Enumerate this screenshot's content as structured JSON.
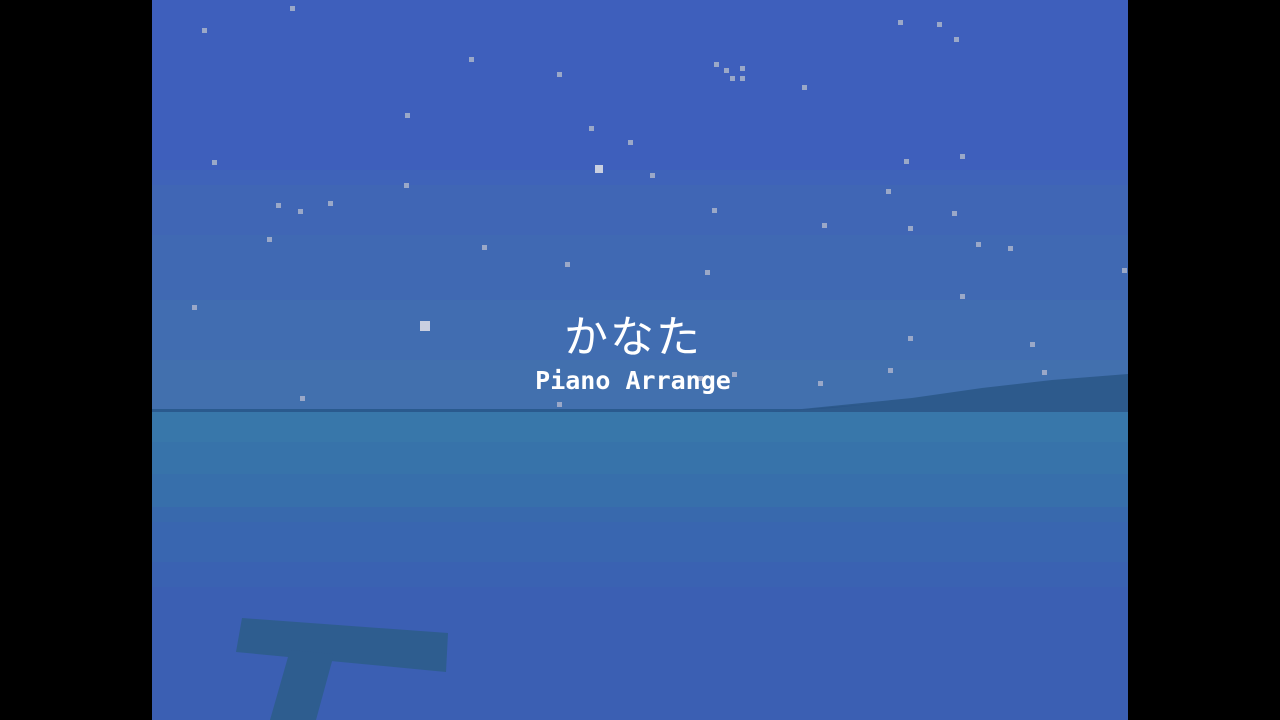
{
  "title": {
    "main": "かなた",
    "subtitle": "Piano Arrange"
  },
  "colors": {
    "sky": "#3e5fbc",
    "sea": "#3877aa",
    "island": "#2d5a8c",
    "star": "#9aa8c8",
    "text": "#ffffff"
  },
  "icons": [
    "star-icon",
    "signpost-icon",
    "island-shape"
  ]
}
